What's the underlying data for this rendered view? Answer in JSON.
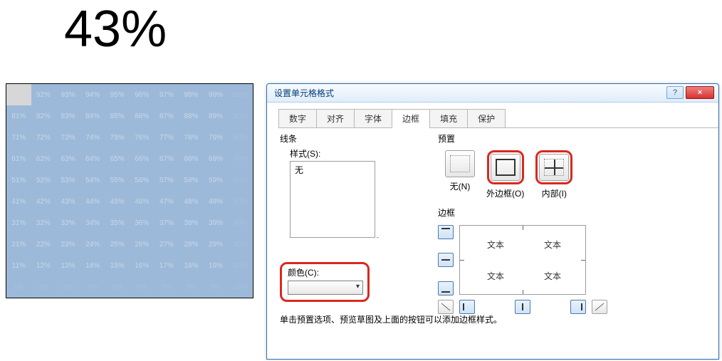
{
  "big_percent": "43%",
  "grid": {
    "rows": [
      [
        "",
        "92%",
        "93%",
        "94%",
        "95%",
        "96%",
        "97%",
        "98%",
        "99%",
        "100%"
      ],
      [
        "81%",
        "82%",
        "83%",
        "84%",
        "85%",
        "86%",
        "87%",
        "88%",
        "89%",
        "90%"
      ],
      [
        "71%",
        "72%",
        "73%",
        "74%",
        "75%",
        "76%",
        "77%",
        "78%",
        "79%",
        "80%"
      ],
      [
        "61%",
        "62%",
        "63%",
        "64%",
        "65%",
        "66%",
        "67%",
        "68%",
        "69%",
        "70%"
      ],
      [
        "51%",
        "52%",
        "53%",
        "54%",
        "55%",
        "56%",
        "57%",
        "58%",
        "59%",
        "60%"
      ],
      [
        "41%",
        "42%",
        "43%",
        "44%",
        "45%",
        "46%",
        "47%",
        "48%",
        "49%",
        "50%"
      ],
      [
        "31%",
        "32%",
        "33%",
        "34%",
        "35%",
        "36%",
        "37%",
        "38%",
        "39%",
        "40%"
      ],
      [
        "21%",
        "22%",
        "23%",
        "24%",
        "25%",
        "26%",
        "27%",
        "28%",
        "29%",
        "30%"
      ],
      [
        "11%",
        "12%",
        "13%",
        "14%",
        "15%",
        "16%",
        "17%",
        "18%",
        "19%",
        "20%"
      ],
      [
        "1%",
        "2%",
        "3%",
        "4%",
        "5%",
        "6%",
        "7%",
        "8%",
        "9%",
        "10%"
      ]
    ]
  },
  "dialog": {
    "title": "设置单元格格式",
    "help": "?",
    "close": "×",
    "tabs": [
      "数字",
      "对齐",
      "字体",
      "边框",
      "填充",
      "保护"
    ],
    "active_tab": 3,
    "lines_label": "线条",
    "style_label": "样式(S):",
    "style_none": "无",
    "color_label": "颜色(C):",
    "preset_label": "预置",
    "preset_none": "无(N)",
    "preset_outer": "外边框(O)",
    "preset_inner": "内部(I)",
    "border_label": "边框",
    "preview_text": "文本",
    "hint": "单击预置选项、预览草图及上面的按钮可以添加边框样式。"
  }
}
